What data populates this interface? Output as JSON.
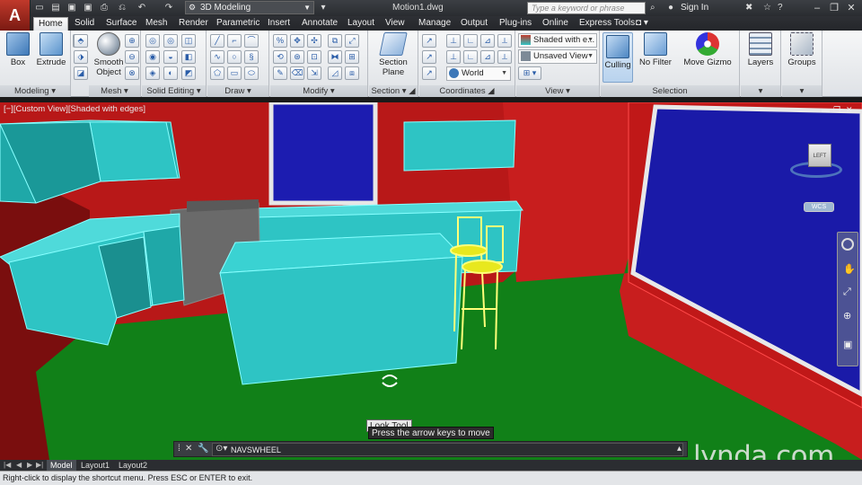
{
  "app": {
    "logo_letter": "A",
    "workspace": "3D Modeling",
    "document_title": "Motion1.dwg",
    "search_placeholder": "Type a keyword or phrase",
    "sign_in": "Sign In"
  },
  "ribbon_tabs": [
    "Home",
    "Solid",
    "Surface",
    "Mesh",
    "Render",
    "Parametric",
    "Insert",
    "Annotate",
    "Layout",
    "View",
    "Manage",
    "Output",
    "Plug-ins",
    "Online",
    "Express Tools"
  ],
  "panels": {
    "modeling": {
      "title": "Modeling",
      "box": "Box",
      "extrude": "Extrude"
    },
    "mesh": {
      "title": "Mesh",
      "smooth_object_1": "Smooth",
      "smooth_object_2": "Object"
    },
    "solid_editing": {
      "title": "Solid Editing"
    },
    "draw": {
      "title": "Draw"
    },
    "modify": {
      "title": "Modify"
    },
    "section": {
      "title": "Section",
      "section_plane_1": "Section",
      "section_plane_2": "Plane"
    },
    "coordinates": {
      "title": "Coordinates",
      "ucs": "World"
    },
    "view": {
      "title": "View",
      "visual_style": "Shaded with e...",
      "named_view": "Unsaved View"
    },
    "selection": {
      "title": "Selection",
      "culling": "Culling",
      "no_filter": "No Filter",
      "move_gizmo": "Move Gizmo"
    },
    "layers": {
      "label": "Layers"
    },
    "groups": {
      "label": "Groups"
    }
  },
  "viewport": {
    "label": "[−][Custom View][Shaded with edges]",
    "viewcube_face": "LEFT",
    "wcs": "WCS"
  },
  "tooltip": {
    "title": "Look Tool",
    "hint": "Press the arrow keys to move"
  },
  "command_line": {
    "value": "NAVSWHEEL"
  },
  "layout_tabs": [
    "Model",
    "Layout1",
    "Layout2"
  ],
  "status": {
    "text": "Right-click to display the shortcut menu. Press ESC or ENTER to exit."
  },
  "watermark": "lynda.com",
  "colors": {
    "wall": "#c01818",
    "floor": "#0e7a14",
    "cabinet": "#2ec4c4",
    "window": "#1c1ca8",
    "stool": "#e8e81e"
  }
}
